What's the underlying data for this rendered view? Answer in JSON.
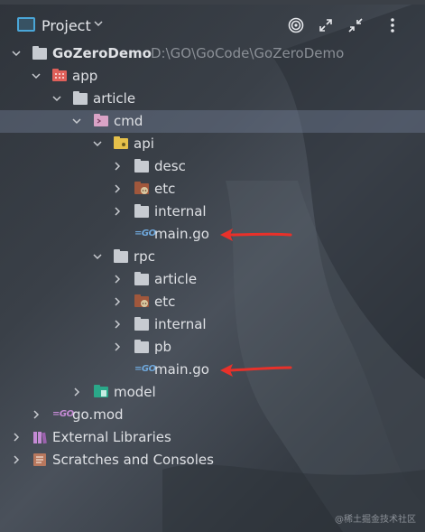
{
  "header": {
    "title": "Project",
    "buttons": [
      "locate-icon",
      "expand-all-icon",
      "collapse-all-icon",
      "more-options-icon"
    ]
  },
  "tree": {
    "root": {
      "label": "GoZeroDemo",
      "path": "D:\\GO\\GoCode\\GoZeroDemo"
    },
    "app": "app",
    "article": "article",
    "cmd": "cmd",
    "api": "api",
    "api_desc": "desc",
    "api_etc": "etc",
    "api_internal": "internal",
    "api_main": "main.go",
    "rpc": "rpc",
    "rpc_article": "article",
    "rpc_etc": "etc",
    "rpc_internal": "internal",
    "rpc_pb": "pb",
    "rpc_main": "main.go",
    "model": "model",
    "gomod": "go.mod",
    "external_libraries": "External Libraries",
    "scratches": "Scratches and Consoles"
  },
  "colors": {
    "selection": "#56627a",
    "annotation_arrow": "#e8312a",
    "go_icon": "#6fa8dc"
  },
  "watermark": "@稀土掘金技术社区"
}
